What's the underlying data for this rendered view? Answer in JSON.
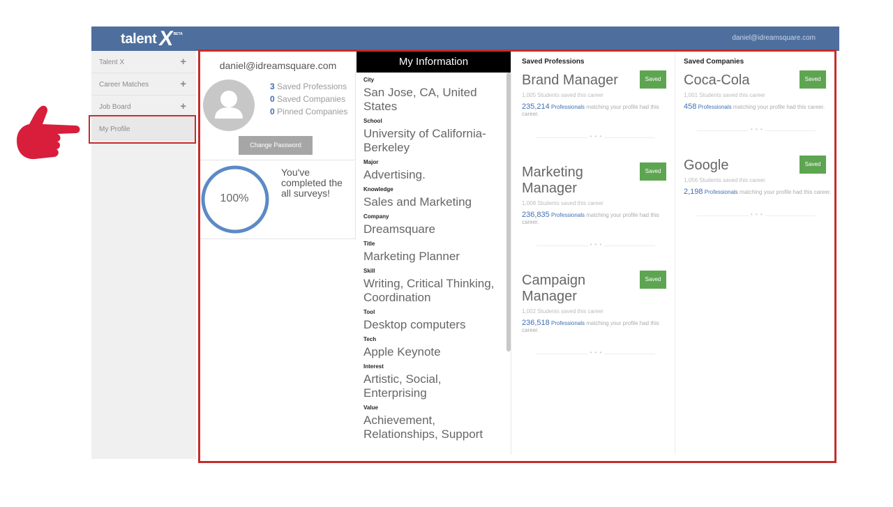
{
  "header": {
    "logo_text": "talent",
    "logo_x": "X",
    "logo_beta": "BETA",
    "user_email": "daniel@idreamsquare.com"
  },
  "sidebar": {
    "items": [
      {
        "label": "Talent X",
        "expand": "+"
      },
      {
        "label": "Career Matches",
        "expand": "+"
      },
      {
        "label": "Job Board",
        "expand": "+"
      },
      {
        "label": "My Profile"
      }
    ]
  },
  "profile": {
    "email": "daniel@idreamsquare.com",
    "saved_professions_count": "3",
    "saved_professions_label": "Saved Professions",
    "saved_companies_count": "0",
    "saved_companies_label": "Saved Companies",
    "pinned_companies_count": "0",
    "pinned_companies_label": "Pinned Companies",
    "change_password": "Change Password"
  },
  "survey": {
    "percent_label": "100%",
    "progress": 1.0,
    "message": "You've completed the all surveys!"
  },
  "my_information": {
    "title": "My Information",
    "fields": [
      {
        "label": "City",
        "value": "San Jose, CA, United States"
      },
      {
        "label": "School",
        "value": "University of California-Berkeley"
      },
      {
        "label": "Major",
        "value": "Advertising."
      },
      {
        "label": "Knowledge",
        "value": "Sales and Marketing"
      },
      {
        "label": "Company",
        "value": "Dreamsquare"
      },
      {
        "label": "Title",
        "value": "Marketing Planner"
      },
      {
        "label": "Skill",
        "value": "Writing, Critical Thinking, Coordination"
      },
      {
        "label": "Tool",
        "value": "Desktop computers"
      },
      {
        "label": "Tech",
        "value": "Apple Keynote"
      },
      {
        "label": "Interest",
        "value": "Artistic, Social, Enterprising"
      },
      {
        "label": "Value",
        "value": "Achievement, Relationships, Support"
      }
    ]
  },
  "saved_professions": {
    "title": "Saved Professions",
    "items": [
      {
        "name": "Brand Manager",
        "badge": "Saved",
        "students": "1,005 Students saved this career",
        "match_count": "235,214",
        "match_pro": "Professionals",
        "match_text": "matching your profile had this career."
      },
      {
        "name": "Marketing Manager",
        "badge": "Saved",
        "students": "1,008 Students saved this career",
        "match_count": "236,835",
        "match_pro": "Professionals",
        "match_text": "matching your profile had this career."
      },
      {
        "name": "Campaign Manager",
        "badge": "Saved",
        "students": "1,002 Students saved this career",
        "match_count": "236,518",
        "match_pro": "Professionals",
        "match_text": "matching your profile had this career."
      }
    ]
  },
  "saved_companies": {
    "title": "Saved Companies",
    "items": [
      {
        "name": "Coca-Cola",
        "badge": "Saved",
        "students": "1,001 Students saved this career",
        "match_count": "458",
        "match_pro": "Professionals",
        "match_text": "matching your profile had this career."
      },
      {
        "name": "Google",
        "badge": "Saved",
        "students": "1,056 Students saved this career",
        "match_count": "2,198",
        "match_pro": "Professionals",
        "match_text": "matching your profile had this career."
      }
    ]
  },
  "separator_dots": "• • •",
  "colors": {
    "header": "#4e6f9d",
    "annotation": "#c42c2c",
    "saved_button": "#5ea552",
    "link_blue": "#3e6fb3",
    "progress_ring": "#5b8ac6"
  }
}
